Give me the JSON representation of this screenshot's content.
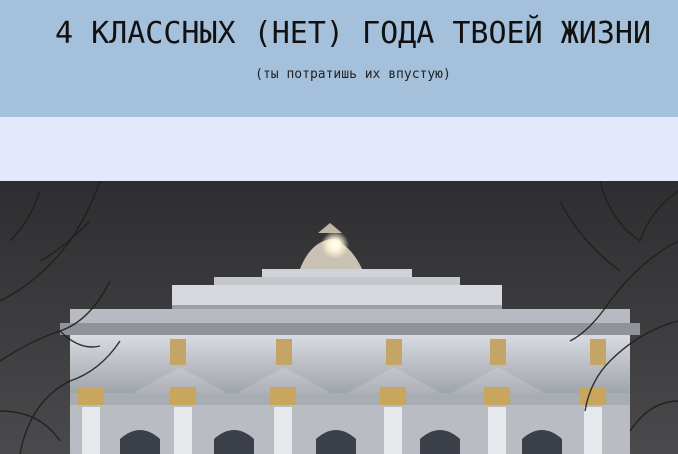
{
  "header": {
    "title": "4 КЛАССНЫХ (НЕТ) ГОДА ТВОЕЙ ЖИЗНИ",
    "subtitle": "(ты потратишь их впустую)"
  },
  "colors": {
    "header_bg": "#a4c0db",
    "band_bg": "#e3e8fd",
    "sky": "#3c3c3e",
    "facade": "#c9cdd2"
  },
  "photo": {
    "icon": "building-facade-photo"
  }
}
